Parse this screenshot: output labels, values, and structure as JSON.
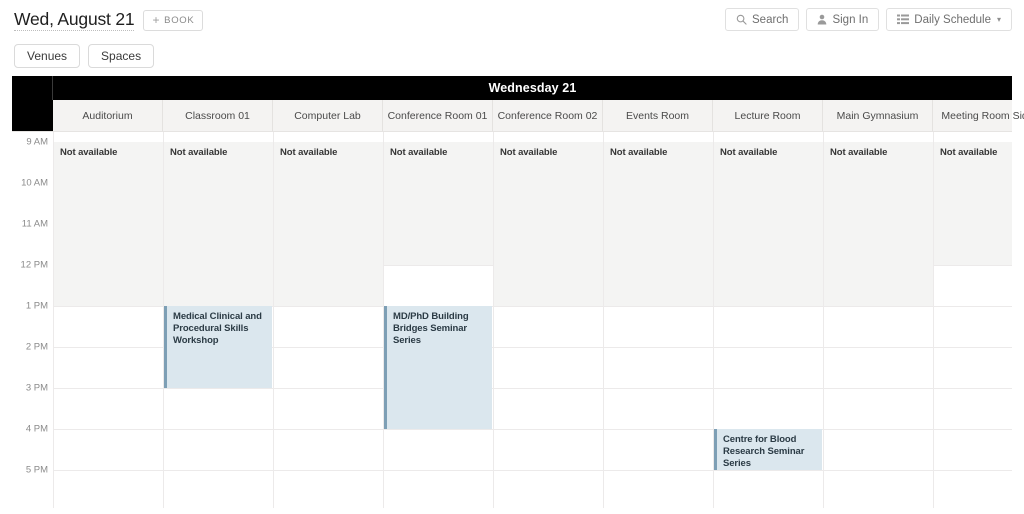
{
  "header": {
    "date_title": "Wed, August 21",
    "book_label": "BOOK",
    "book_icon": "plus-icon",
    "search_label": "Search",
    "search_icon": "search-icon",
    "signin_label": "Sign In",
    "signin_icon": "person-icon",
    "view_label": "Daily Schedule",
    "view_icon": "list-icon",
    "view_caret": "▾"
  },
  "filters": [
    {
      "label": "Venues",
      "name": "venues"
    },
    {
      "label": "Spaces",
      "name": "spaces"
    }
  ],
  "calendar": {
    "day_label": "Wednesday 21",
    "not_available_label": "Not available",
    "columns": [
      "Auditorium",
      "Classroom 01",
      "Computer Lab",
      "Conference Room 01",
      "Conference Room 02",
      "Events Room",
      "Lecture Room",
      "Main Gymnasium",
      "Meeting Room Side"
    ],
    "times": [
      "9 AM",
      "10 AM",
      "11 AM",
      "12 PM",
      "1 PM",
      "2 PM",
      "3 PM",
      "4 PM",
      "5 PM"
    ],
    "unavailable": [
      {
        "column": 0,
        "start": "9 AM",
        "end": "1 PM"
      },
      {
        "column": 1,
        "start": "9 AM",
        "end": "1 PM"
      },
      {
        "column": 2,
        "start": "9 AM",
        "end": "1 PM"
      },
      {
        "column": 3,
        "start": "9 AM",
        "end": "12 PM"
      },
      {
        "column": 4,
        "start": "9 AM",
        "end": "1 PM"
      },
      {
        "column": 5,
        "start": "9 AM",
        "end": "1 PM"
      },
      {
        "column": 6,
        "start": "9 AM",
        "end": "1 PM"
      },
      {
        "column": 7,
        "start": "9 AM",
        "end": "1 PM"
      },
      {
        "column": 8,
        "start": "9 AM",
        "end": "12 PM"
      }
    ],
    "events": [
      {
        "title": "Medical Clinical and Procedural Skills Workshop",
        "column": 1,
        "start": "1 PM",
        "end": "3 PM",
        "color": "#dbe7ee",
        "accent": "#7d9fb5"
      },
      {
        "title": "MD/PhD Building Bridges Seminar Series",
        "column": 3,
        "start": "1 PM",
        "end": "4 PM",
        "color": "#dbe7ee",
        "accent": "#7d9fb5"
      },
      {
        "title": "Centre for Blood Research Seminar Series",
        "column": 6,
        "start": "4 PM",
        "end": "5 PM",
        "color": "#dbe7ee",
        "accent": "#7d9fb5"
      }
    ]
  }
}
